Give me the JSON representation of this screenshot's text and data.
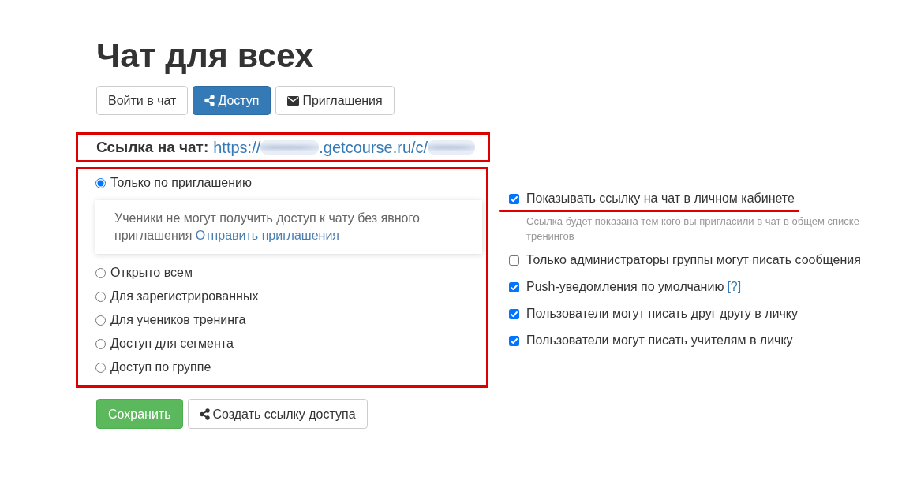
{
  "page": {
    "title": "Чат для всех"
  },
  "tabs": [
    {
      "label": "Войти в чат",
      "kind": "plain",
      "selected": false
    },
    {
      "label": "Доступ",
      "kind": "share",
      "selected": true
    },
    {
      "label": "Приглашения",
      "kind": "mail",
      "selected": false
    }
  ],
  "chat_link": {
    "label": "Ссылка на чат:",
    "highlighted": true,
    "url_parts": [
      {
        "kind": "text",
        "text": "https://"
      },
      {
        "kind": "blurred"
      },
      {
        "kind": "text",
        "text": ".getcourse.ru/c/"
      },
      {
        "kind": "blurred"
      }
    ]
  },
  "access": {
    "highlighted": true,
    "options": [
      {
        "label": "Только по приглашению",
        "selected": true,
        "note": {
          "text": "Ученики не могут получить доступ к чату без явного приглашения",
          "link": "Отправить приглашения"
        }
      },
      {
        "label": "Открыто всем",
        "selected": false
      },
      {
        "label": "Для зарегистрированных",
        "selected": false
      },
      {
        "label": "Для учеников тренинга",
        "selected": false
      },
      {
        "label": "Доступ для сегмента",
        "selected": false
      },
      {
        "label": "Доступ по группе",
        "selected": false
      }
    ]
  },
  "settings": [
    {
      "label": "Показывать ссылку на чат в личном кабинете",
      "checked": true,
      "underlined": true,
      "hint": "Ссылка будет показана тем кого вы пригласили в чат в общем списке тренингов"
    },
    {
      "label": "Только администраторы группы могут писать сообщения",
      "checked": false,
      "underlined": false
    },
    {
      "label": "Push-уведомления по умолчанию",
      "checked": true,
      "underlined": false,
      "help_link": "[?]"
    },
    {
      "label": "Пользователи могут писать друг другу в личку",
      "checked": true,
      "underlined": false
    },
    {
      "label": "Пользователи могут писать учителям в личку",
      "checked": true,
      "underlined": false
    }
  ],
  "actions": [
    {
      "label": "Сохранить",
      "kind": "primary"
    },
    {
      "label": "Создать ссылку доступа",
      "kind": "share"
    }
  ]
}
